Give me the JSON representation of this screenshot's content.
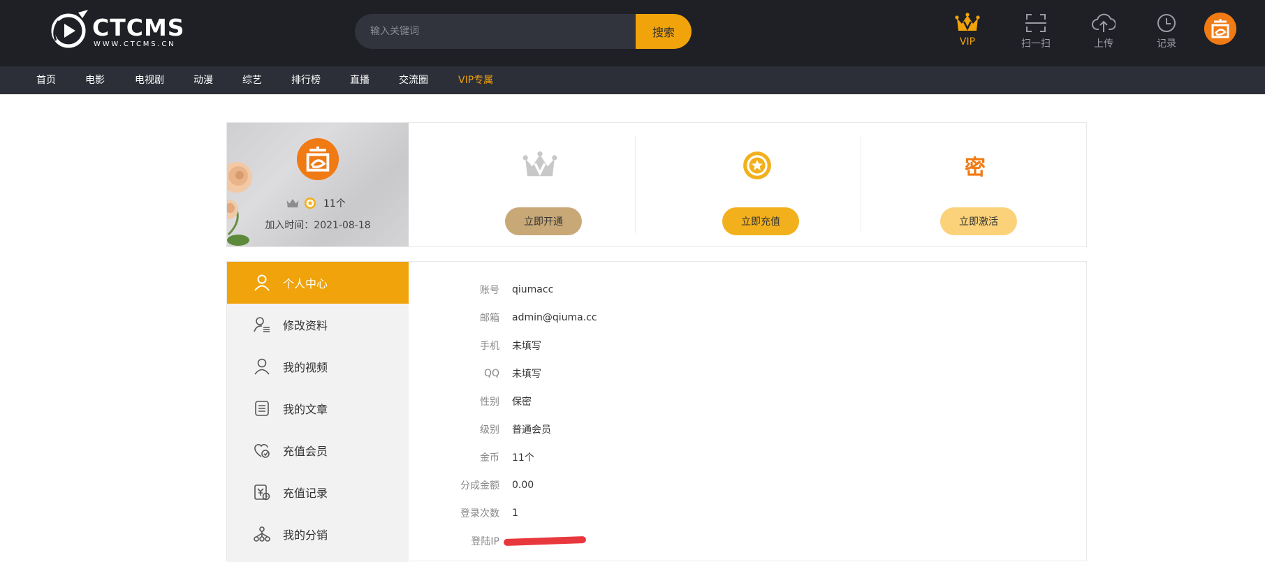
{
  "header": {
    "logo_text": "CTCMS",
    "logo_sub": "WWW.CTCMS.CN",
    "search_placeholder": "输入关键词",
    "search_button": "搜索",
    "tools": [
      {
        "icon": "crown-icon",
        "label": "VIP"
      },
      {
        "icon": "scan-icon",
        "label": "扫一扫"
      },
      {
        "icon": "upload-icon",
        "label": "上传"
      },
      {
        "icon": "history-icon",
        "label": "记录"
      }
    ]
  },
  "nav": {
    "items": [
      "首页",
      "电影",
      "电视剧",
      "动漫",
      "综艺",
      "排行榜",
      "直播",
      "交流圈",
      "VIP专属"
    ]
  },
  "profile": {
    "coins": "11个",
    "join_date": "加入时间：2021-08-18",
    "actions": [
      {
        "icon": "crown-icon",
        "label": "立即开通",
        "color": "#c9a877"
      },
      {
        "icon": "star-medal-icon",
        "label": "立即充值",
        "color": "#f2b01c"
      },
      {
        "icon": "secret-icon",
        "label": "立即激活",
        "char": "密",
        "color": "#fbd27a"
      }
    ]
  },
  "sidebar": {
    "items": [
      {
        "label": "个人中心",
        "icon": "user-icon",
        "active": true
      },
      {
        "label": "修改资料",
        "icon": "user-edit-icon"
      },
      {
        "label": "我的视频",
        "icon": "user-video-icon"
      },
      {
        "label": "我的文章",
        "icon": "article-icon"
      },
      {
        "label": "充值会员",
        "icon": "vip-recharge-icon"
      },
      {
        "label": "充值记录",
        "icon": "record-icon"
      },
      {
        "label": "我的分销",
        "icon": "distribution-icon"
      }
    ]
  },
  "account_info": [
    {
      "key": "账号",
      "value": "qiumacc"
    },
    {
      "key": "邮箱",
      "value": "admin@qiuma.cc"
    },
    {
      "key": "手机",
      "value": "未填写"
    },
    {
      "key": "QQ",
      "value": "未填写"
    },
    {
      "key": "性别",
      "value": "保密"
    },
    {
      "key": "级别",
      "value": "普通会员"
    },
    {
      "key": "金币",
      "value": "11个"
    },
    {
      "key": "分成金额",
      "value": "0.00"
    },
    {
      "key": "登录次数",
      "value": "1"
    },
    {
      "key": "登陆IP",
      "value": ""
    }
  ],
  "colors": {
    "header_bg": "#1f2026",
    "nav_bg": "#2c2e38",
    "accent": "#f0a30a",
    "brand_orange": "#f07a14"
  }
}
